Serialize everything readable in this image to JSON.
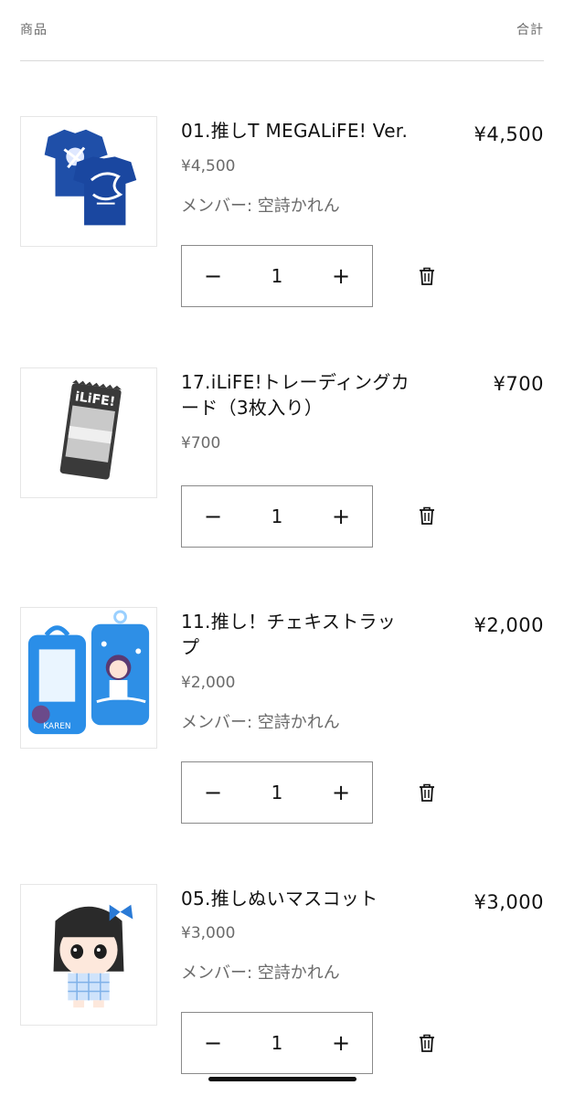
{
  "header": {
    "product_label": "商品",
    "total_label": "合計"
  },
  "items": [
    {
      "title": "01.推しT MEGALiFE! Ver.",
      "unit_price": "¥4,500",
      "member": "メンバー: 空詩かれん",
      "total": "¥4,500",
      "quantity": "1",
      "minus": "−",
      "plus": "+"
    },
    {
      "title": "17.iLiFE!トレーディングカード（3枚入り）",
      "unit_price": "¥700",
      "total": "¥700",
      "quantity": "1",
      "minus": "−",
      "plus": "+",
      "image_text": "iLiFE!"
    },
    {
      "title": "11.推し！チェキストラップ",
      "unit_price": "¥2,000",
      "member": "メンバー: 空詩かれん",
      "total": "¥2,000",
      "quantity": "1",
      "minus": "−",
      "plus": "+",
      "image_text": "KAREN"
    },
    {
      "title": "05.推しぬいマスコット",
      "unit_price": "¥3,000",
      "member": "メンバー: 空詩かれん",
      "total": "¥3,000",
      "quantity": "1",
      "minus": "−",
      "plus": "+"
    }
  ],
  "colors": {
    "text": "#121212",
    "muted": "#6b6b6b",
    "border": "#8a8a8a",
    "shirt_blue": "#1f4fa8",
    "strap_blue": "#2a8ee8"
  },
  "icons": [
    "minus-icon",
    "plus-icon",
    "trash-icon"
  ]
}
